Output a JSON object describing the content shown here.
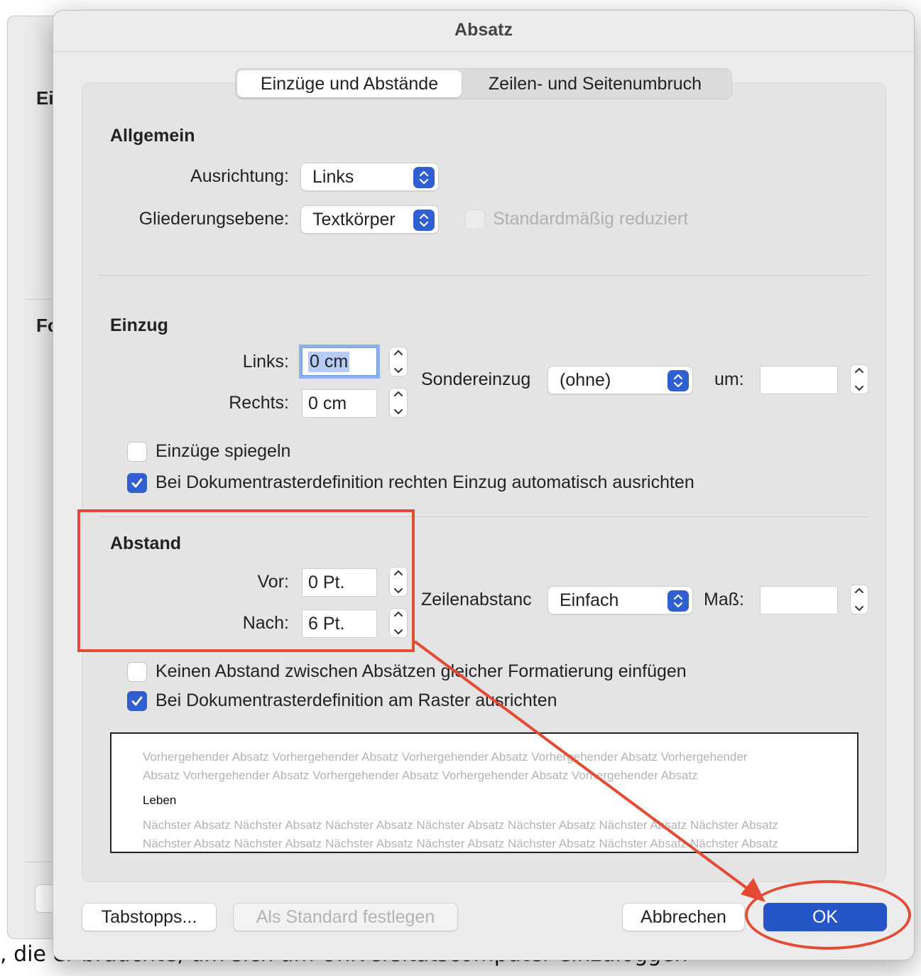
{
  "dialog": {
    "title": "Absatz"
  },
  "tabs": [
    {
      "label": "Einzüge und Abstände",
      "active": true
    },
    {
      "label": "Zeilen- und Seitenumbruch",
      "active": false
    }
  ],
  "allgemein": {
    "title": "Allgemein",
    "ausrichtung_label": "Ausrichtung:",
    "ausrichtung_value": "Links",
    "gliederung_label": "Gliederungsebene:",
    "gliederung_value": "Textkörper",
    "standard_reduziert_label": "Standardmäßig reduziert"
  },
  "einzug": {
    "title": "Einzug",
    "links_label": "Links:",
    "links_value": "0 cm",
    "rechts_label": "Rechts:",
    "rechts_value": "0 cm",
    "sondereinzug_label": "Sondereinzug",
    "sondereinzug_value": "(ohne)",
    "um_label": "um:",
    "um_value": "",
    "spiegeln_label": "Einzüge spiegeln",
    "spiegeln_checked": false,
    "raster_label": "Bei Dokumentrasterdefinition rechten Einzug automatisch ausrichten",
    "raster_checked": true
  },
  "abstand": {
    "title": "Abstand",
    "vor_label": "Vor:",
    "vor_value": "0 Pt.",
    "nach_label": "Nach:",
    "nach_value": "6 Pt.",
    "zeilenabstand_label": "Zeilenabstanc",
    "zeilenabstand_value": "Einfach",
    "mass_label": "Maß:",
    "mass_value": "",
    "kein_abstand_label": "Keinen Abstand zwischen Absätzen gleicher Formatierung einfügen",
    "kein_abstand_checked": false,
    "am_raster_label": "Bei Dokumentrasterdefinition am Raster ausrichten",
    "am_raster_checked": true
  },
  "preview": {
    "previous_line1": "Vorhergehender Absatz Vorhergehender Absatz Vorhergehender Absatz Vorhergehender Absatz Vorhergehender",
    "previous_line2": "Absatz Vorhergehender Absatz Vorhergehender Absatz Vorhergehender Absatz Vorhergehender Absatz",
    "current": "Leben",
    "next_line1": "Nächster Absatz Nächster Absatz Nächster Absatz Nächster Absatz Nächster Absatz Nächster Absatz Nächster Absatz",
    "next_line2": "Nächster Absatz Nächster Absatz Nächster Absatz Nächster Absatz Nächster Absatz Nächster Absatz Nächster Absatz"
  },
  "buttons": {
    "tabstopps": "Tabstopps...",
    "als_standard": "Als Standard festlegen",
    "abbrechen": "Abbrechen",
    "ok": "OK"
  },
  "background": {
    "window_label1": "Ei",
    "window_label2": "Fo",
    "bottom_text": ", die er brauchte, um sich am Universitätscomputer einzuloggen"
  },
  "colors": {
    "accent": "#2555c6",
    "annotation": "#e34b34",
    "dialog_bg": "#ececec"
  }
}
